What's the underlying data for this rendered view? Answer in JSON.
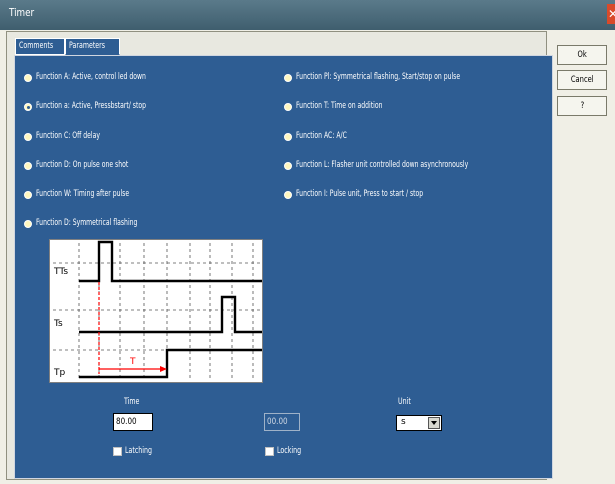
{
  "window": {
    "title": "Timer",
    "close_glyph": "✕"
  },
  "tabs": [
    {
      "label": "Comments",
      "active": false
    },
    {
      "label": "Parameters",
      "active": true
    }
  ],
  "functions": {
    "left": [
      {
        "label": "Function A: Active, control led down",
        "selected": false
      },
      {
        "label": "Function a: Active, Pressbstart/ stop",
        "selected": true
      },
      {
        "label": "Function C: Off delay",
        "selected": false
      },
      {
        "label": "Function D: On pulse one shot",
        "selected": false
      },
      {
        "label": "Function W: Timing after pulse",
        "selected": false
      },
      {
        "label": "Function D: Symmetrical flashing",
        "selected": false
      }
    ],
    "right": [
      {
        "label": "Function Pl: Symmetrical flashing, Start/stop on pulse",
        "selected": false
      },
      {
        "label": "Function T: Time on addition",
        "selected": false
      },
      {
        "label": "Function AC: A/C",
        "selected": false
      },
      {
        "label": "Function L: Flasher unit controlled down asynchronously",
        "selected": false
      },
      {
        "label": "Function I: Pulse unit, Press to start / stop",
        "selected": false
      }
    ]
  },
  "buttons": {
    "ok": "Ok",
    "cancel": "Cancel",
    "help": "?"
  },
  "diagram": {
    "signals": [
      "TTs",
      "Ts",
      "Tp"
    ],
    "time_marker": "T",
    "colors": {
      "signal": "#000000",
      "marker": "#ff0000",
      "grid": "#555555"
    }
  },
  "time": {
    "label": "Time",
    "value": "80.00"
  },
  "time2": {
    "value": "00.00"
  },
  "unit": {
    "label": "Unit",
    "value": "s"
  },
  "checks": {
    "left": "Latching",
    "right": "Locking"
  },
  "colors": {
    "panel": "#2e5d93",
    "titlebar": "#4a6b7c",
    "close": "#d84a2a"
  }
}
